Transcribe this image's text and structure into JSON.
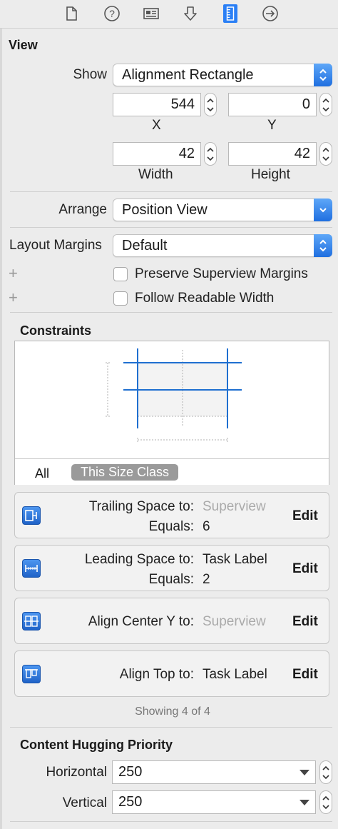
{
  "toolbar": {
    "icons": [
      "file-inspector-icon",
      "quick-help-icon",
      "identity-inspector-icon",
      "attributes-inspector-icon",
      "size-inspector-icon",
      "connections-inspector-icon"
    ],
    "active": "size-inspector-icon",
    "accent": "#2a7ff5"
  },
  "view": {
    "title": "View",
    "show_label": "Show",
    "show_value": "Alignment Rectangle",
    "x_value": "544",
    "y_value": "0",
    "x_label": "X",
    "y_label": "Y",
    "width_value": "42",
    "height_value": "42",
    "width_label": "Width",
    "height_label": "Height",
    "arrange_label": "Arrange",
    "arrange_value": "Position View",
    "layout_margins_label": "Layout Margins",
    "layout_margins_value": "Default",
    "preserve_label": "Preserve Superview Margins",
    "follow_label": "Follow Readable Width",
    "plus_symbol": "+"
  },
  "constraints": {
    "title": "Constraints",
    "seg_all": "All",
    "seg_size_class": "This Size Class",
    "items": [
      {
        "label1": "Trailing Space to:",
        "value1": "Superview",
        "value1_dim": true,
        "label2": "Equals:",
        "value2": "6",
        "edit": "Edit",
        "icon": "trailing-space-icon"
      },
      {
        "label1": "Leading Space to:",
        "value1": "Task Label",
        "value1_dim": false,
        "label2": "Equals:",
        "value2": "2",
        "edit": "Edit",
        "icon": "leading-space-icon"
      },
      {
        "label1": "Align Center Y to:",
        "value1": "Superview",
        "value1_dim": true,
        "edit": "Edit",
        "icon": "align-center-y-icon"
      },
      {
        "label1": "Align Top to:",
        "value1": "Task Label",
        "value1_dim": false,
        "edit": "Edit",
        "icon": "align-top-icon"
      }
    ],
    "showing": "Showing 4 of 4"
  },
  "hugging": {
    "title": "Content Hugging Priority",
    "horizontal_label": "Horizontal",
    "horizontal_value": "250",
    "vertical_label": "Vertical",
    "vertical_value": "250"
  }
}
